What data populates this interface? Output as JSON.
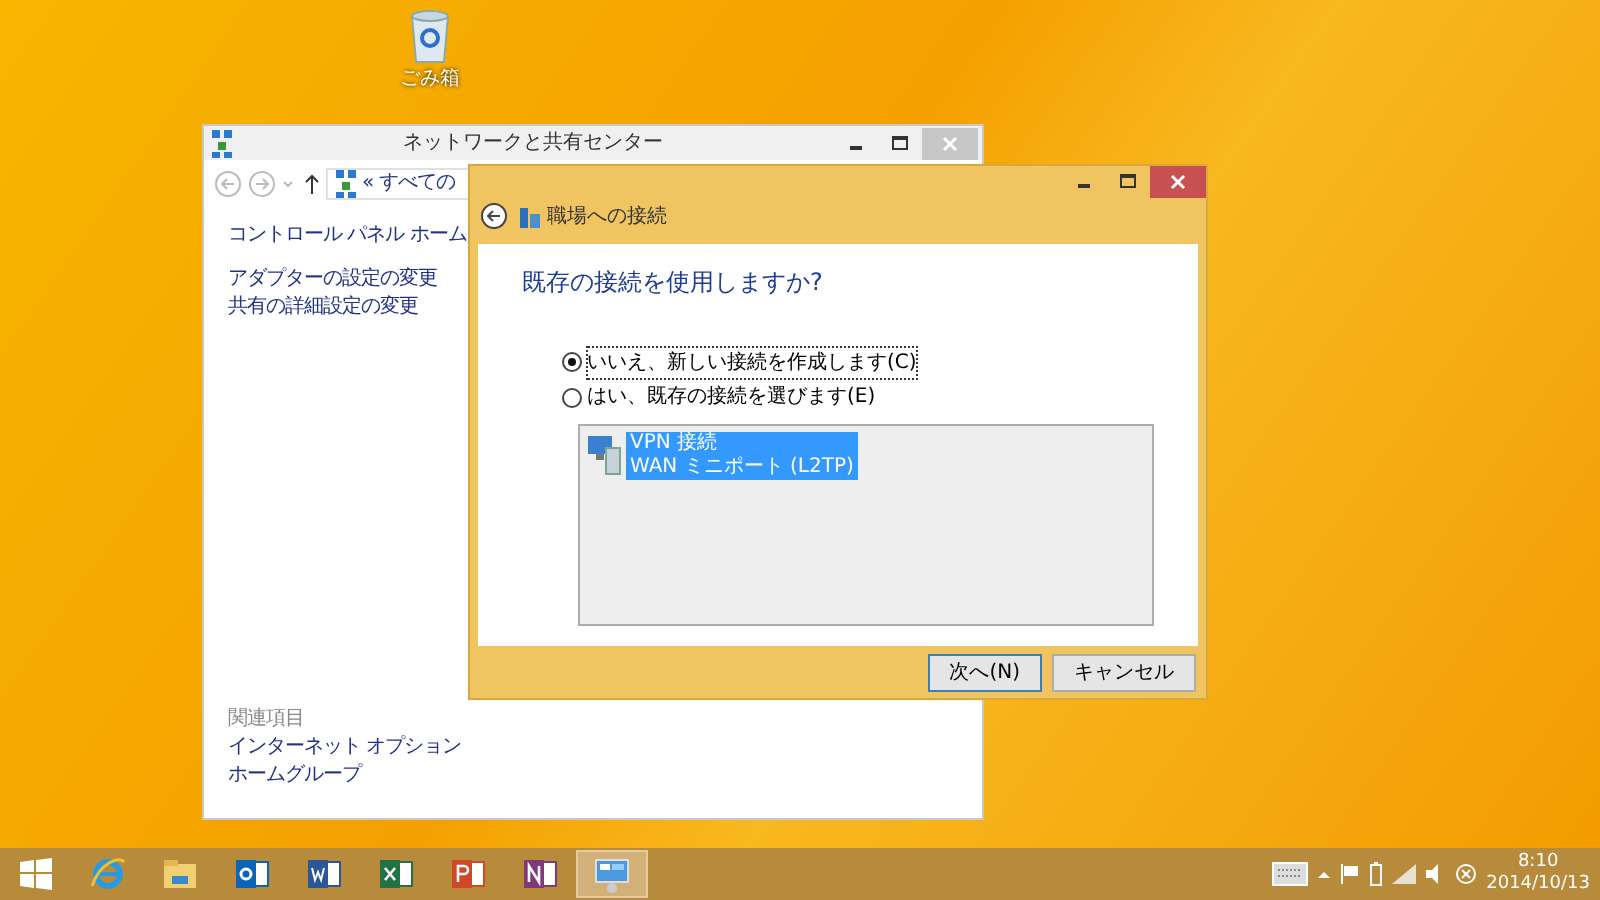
{
  "desktop_icons": [
    {
      "label": "ごみ箱"
    }
  ],
  "back_window": {
    "title": "ネットワークと共有センター",
    "address": "« すべての",
    "nav_links": [
      "コントロール パネル ホーム",
      "アダプターの設定の変更",
      "共有の詳細設定の変更"
    ],
    "related_heading": "関連項目",
    "related_links": [
      "インターネット オプション",
      "ホームグループ"
    ]
  },
  "dialog": {
    "title": "職場への接続",
    "question": "既存の接続を使用しますか?",
    "options": [
      {
        "label": "いいえ、新しい接続を作成します(C)",
        "selected": true
      },
      {
        "label": "はい、既存の接続を選びます(E)",
        "selected": false
      }
    ],
    "connections": [
      {
        "name": "VPN 接続",
        "detail": "WAN ミニポート (L2TP)",
        "selected": true
      }
    ],
    "buttons": [
      "次へ(N)",
      "キャンセル"
    ]
  },
  "taskbar": {
    "apps": [
      {
        "kind": "ie",
        "active": false
      },
      {
        "kind": "explorer",
        "active": false
      },
      {
        "kind": "outlook",
        "active": false
      },
      {
        "kind": "word",
        "active": false
      },
      {
        "kind": "excel",
        "active": false
      },
      {
        "kind": "powerpoint",
        "active": false
      },
      {
        "kind": "onenote",
        "active": false
      },
      {
        "kind": "controlpanel",
        "active": true
      }
    ],
    "time": "8:10",
    "date": "2014/10/13"
  }
}
